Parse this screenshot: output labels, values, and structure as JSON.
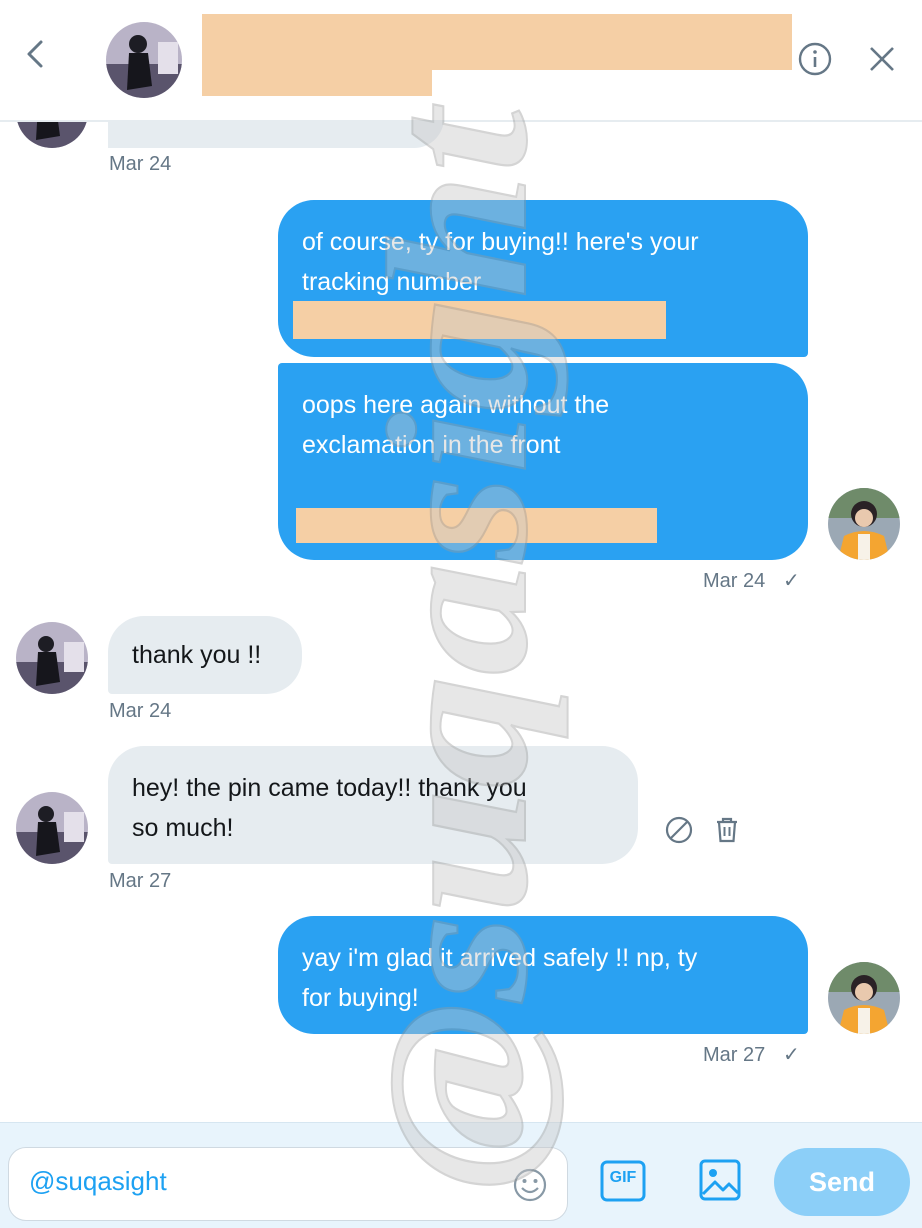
{
  "header": {
    "back_icon": "chevron-left-icon",
    "info_icon": "info-icon",
    "close_icon": "close-icon"
  },
  "messages": [
    {
      "direction": "in",
      "text": "",
      "timestamp": "Mar 24"
    },
    {
      "direction": "out",
      "text": "of course, ty for buying!! here's your\ntracking number",
      "redacted": true
    },
    {
      "direction": "out",
      "text": "oops here again without the\nexclamation in the front",
      "redacted": true,
      "timestamp": "Mar 24",
      "status": "✓"
    },
    {
      "direction": "in",
      "text": "thank you !!",
      "timestamp": "Mar 24"
    },
    {
      "direction": "in",
      "text": "hey! the pin came today!! thank you\nso much!",
      "timestamp": "Mar 27",
      "actions": [
        "report-icon",
        "trash-icon"
      ]
    },
    {
      "direction": "out",
      "text": "yay i'm glad it arrived safely !! np, ty\nfor buying!",
      "timestamp": "Mar 27",
      "status": "✓"
    }
  ],
  "composer": {
    "input_value": "@suqasight",
    "emoji_icon": "emoji-icon",
    "gif_label": "GIF",
    "image_icon": "image-icon",
    "send_label": "Send"
  },
  "watermark": {
    "text": "@suqasight"
  },
  "colors": {
    "outgoing_bubble": "#2aa1f2",
    "incoming_bubble": "#e6ecf0",
    "redaction": "#f5cfa5",
    "accent": "#1da1f2",
    "timestamp": "#657786"
  }
}
